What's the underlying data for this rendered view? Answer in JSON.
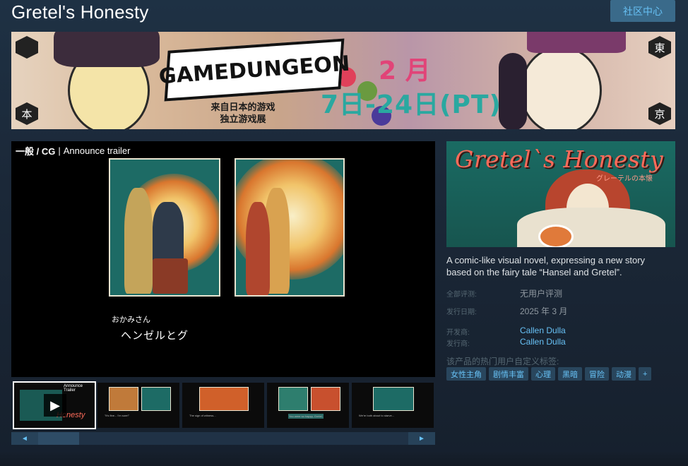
{
  "header": {
    "title": "Gretel's Honesty",
    "community_button": "社区中心"
  },
  "banner": {
    "logo_text": "GAMEDUNGEON",
    "subtitle_line1": "来自日本的游戏",
    "subtitle_line2": "独立游戏展",
    "month": "2 月",
    "dates": "7日-24日(PT)",
    "badge_top_left": "",
    "badge_bottom_left": "本",
    "badge_top_right": "東",
    "badge_bottom_right": "京"
  },
  "media": {
    "category_label": "一般 / CG",
    "video_title": "Announce trailer",
    "speaker": "おかみさん",
    "dialog_line": "ヘンゼルとグ",
    "thumbnails": [
      {
        "label": "Announce Trailer",
        "caption": "Honesty"
      },
      {
        "label": "",
        "caption": "\"It's fine... I'm sure!\""
      },
      {
        "label": "",
        "caption": "The sign of witness..."
      },
      {
        "label": "",
        "caption": "You were so happy, Gretel."
      },
      {
        "label": "",
        "caption": "We're both about to starve..."
      }
    ],
    "scroll_left_icon": "◄",
    "scroll_right_icon": "►"
  },
  "game": {
    "capsule_title": "Gretel`s Honesty",
    "capsule_subtitle": "グレーテルの本懐",
    "description": "A comic-like visual novel, expressing a new story based on the fairy tale “Hansel and Gretel”.",
    "review_label": "全部评测:",
    "review_value": "无用户评测",
    "release_label": "发行日期:",
    "release_value": "2025 年 3 月",
    "developer_label": "开发商:",
    "developer_value": "Callen Dulla",
    "publisher_label": "发行商:",
    "publisher_value": "Callen Dulla",
    "tags_heading": "该产品的热门用户自定义标签:",
    "tags": [
      "女性主角",
      "剧情丰富",
      "心理",
      "黑暗",
      "冒险",
      "动漫",
      "+"
    ]
  },
  "colors": {
    "background": "#1b2838",
    "link_blue": "#67c1f5",
    "tag_bg": "#29465d",
    "title_red": "#ff6b5a",
    "panel_teal": "#1d6b65"
  }
}
